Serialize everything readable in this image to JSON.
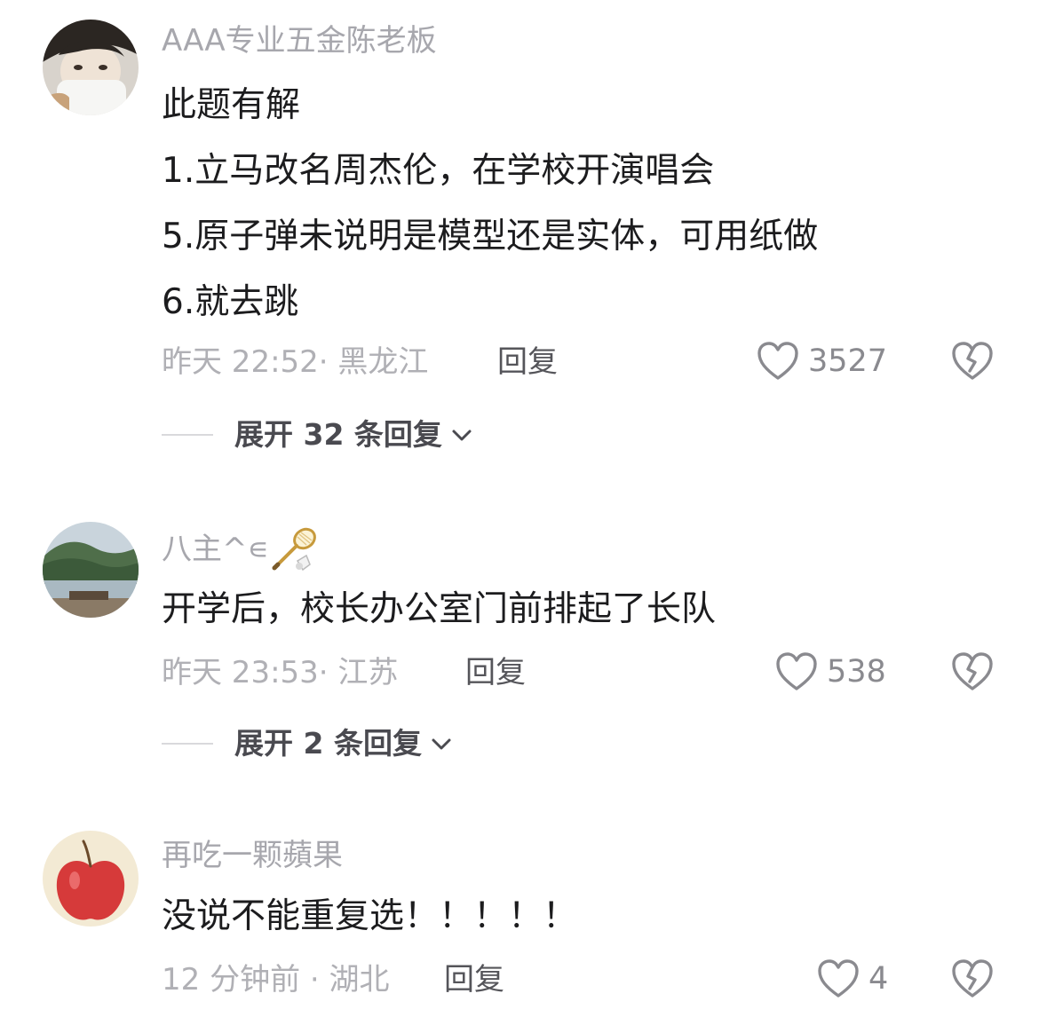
{
  "comments": [
    {
      "username": "AAA专业五金陈老板",
      "lines": [
        "此题有解",
        "1.立马改名周杰伦，在学校开演唱会",
        "5.原子弹未说明是模型还是实体，可用纸做",
        "6.就去跳"
      ],
      "meta": "昨天 22:52· 黑龙江",
      "reply_label": "回复",
      "likes": "3527",
      "expand_label": "展开 32 条回复"
    },
    {
      "username": "八主^∊",
      "username_icon": "badminton-icon",
      "lines": [
        "开学后，校长办公室门前排起了长队"
      ],
      "meta": "昨天 23:53· 江苏",
      "reply_label": "回复",
      "likes": "538",
      "expand_label": "展开 2 条回复"
    },
    {
      "username": "再吃一颗蘋果",
      "lines": [
        "没说不能重复选！！！！！"
      ],
      "meta": "12 分钟前 · 湖北",
      "reply_label": "回复",
      "likes": "4"
    }
  ]
}
